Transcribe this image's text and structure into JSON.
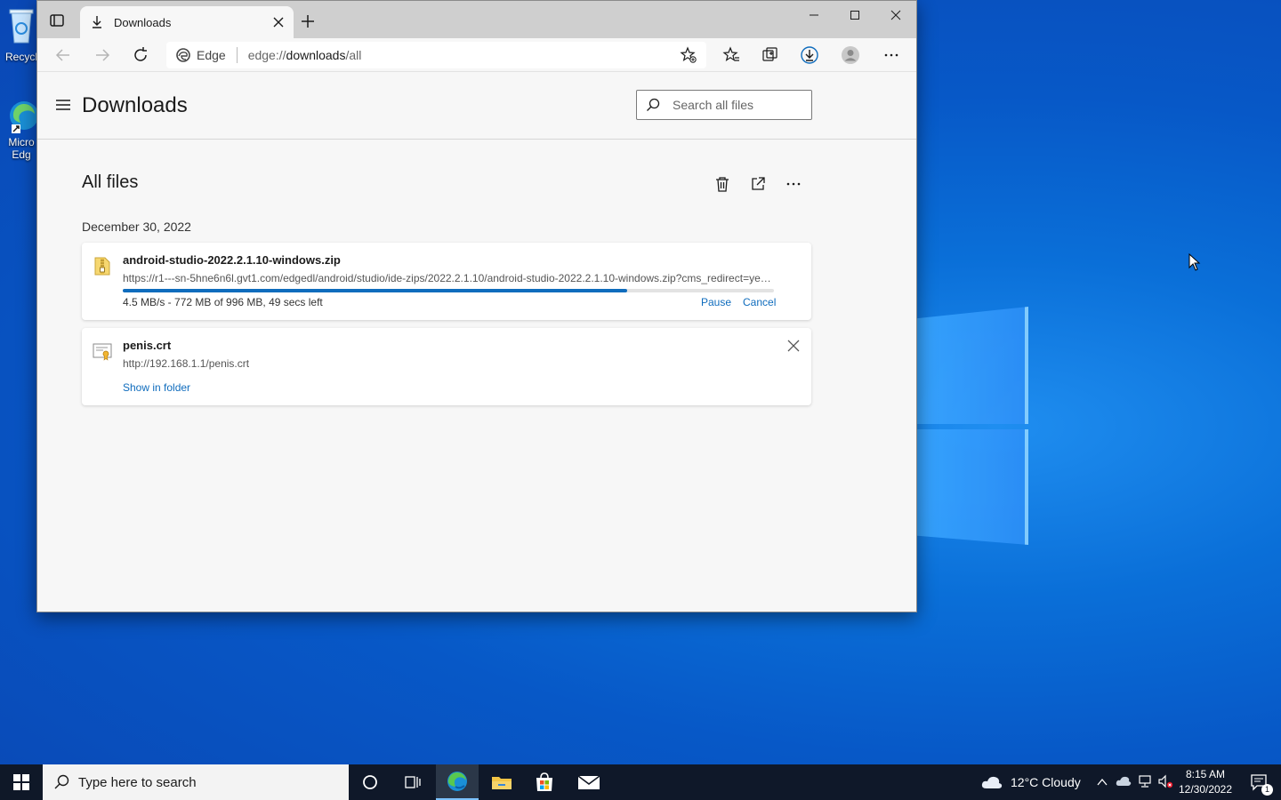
{
  "desktop": {
    "icons": [
      {
        "label": "Recycl"
      },
      {
        "label_line1": "Micro",
        "label_line2": "Edg"
      }
    ]
  },
  "browser": {
    "tab_title": "Downloads",
    "address": {
      "site_label": "Edge",
      "url_prefix": "edge://",
      "url_host": "downloads",
      "url_path": "/all"
    },
    "page_title": "Downloads",
    "search_placeholder": "Search all files",
    "section_title": "All files",
    "date_group": "December 30, 2022",
    "downloads": [
      {
        "filename": "android-studio-2022.2.1.10-windows.zip",
        "url": "https://r1---sn-5hne6n6l.gvt1.com/edgedl/android/studio/ide-zips/2022.2.1.10/android-studio-2022.2.1.10-windows.zip?cms_redirect=yes&mh=...",
        "status": "4.5 MB/s - 772 MB of 996 MB, 49 secs left",
        "progress_fraction": 0.775,
        "actions": [
          "Pause",
          "Cancel"
        ],
        "icon": "zip-file-icon"
      },
      {
        "filename": "penis.crt",
        "url": "http://192.168.1.1/penis.crt",
        "action": "Show in folder",
        "icon": "certificate-file-icon"
      }
    ]
  },
  "taskbar": {
    "search_placeholder": "Type here to search",
    "weather": "12°C  Cloudy",
    "time": "8:15 AM",
    "date": "12/30/2022",
    "notification_count": "1"
  },
  "colors": {
    "accent": "#0f6cbd",
    "taskbar_bg": "#101622",
    "desktop_bg": "#0758c7"
  }
}
